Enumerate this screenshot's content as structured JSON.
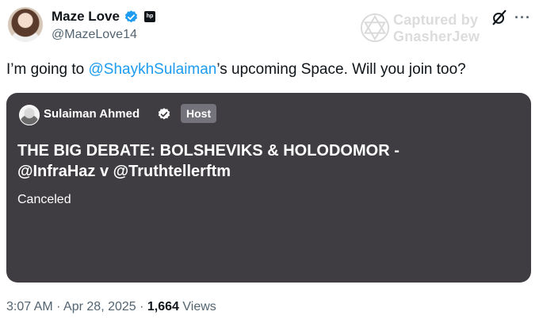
{
  "author": {
    "name": "Maze Love",
    "handle": "@MazeLove14",
    "affiliate_badge": "hp"
  },
  "watermark": {
    "line1": "Captured by",
    "line2": "GnasherJew"
  },
  "tweet": {
    "text_before": "I’m going to ",
    "mention": "@ShaykhSulaiman",
    "text_after": "’s upcoming Space. Will you join too?"
  },
  "space": {
    "host_name": "Sulaiman Ahmed",
    "host_badge": "Host",
    "title_line1": "THE BIG DEBATE: BOLSHEVIKS & HOLODOMOR -",
    "title_line2": "@InfraHaz v @Truthtellerftm",
    "status": "Canceled"
  },
  "footer": {
    "time": "3:07 AM",
    "separator1": " · ",
    "date": "Apr 28, 2025",
    "separator2": " · ",
    "views_count": "1,664",
    "views_label": " Views"
  },
  "colors": {
    "accent": "#1d9bf0",
    "card": "#3f3d42",
    "muted": "#536471"
  }
}
